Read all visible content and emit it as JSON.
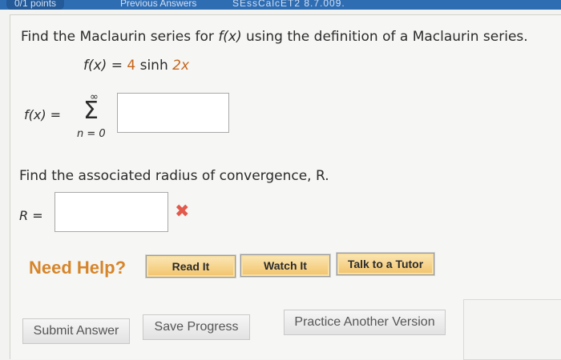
{
  "header": {
    "points": "0/1 points",
    "previous_answers": "Previous Answers",
    "problem_id": "SEssCalcET2 8.7.009."
  },
  "question1": {
    "prompt_prefix": "Find the Maclaurin series for ",
    "prompt_func": "f(x)",
    "prompt_suffix": " using the definition of a Maclaurin series.",
    "function_lhs": "f(x) = ",
    "coef": "4",
    "func_name": " sinh ",
    "arg": "2x"
  },
  "series": {
    "lhs": "f(x) = ",
    "upper": "∞",
    "symbol": "Σ",
    "lower": "n = 0",
    "answer_value": ""
  },
  "question2": {
    "prompt": "Find the associated radius of convergence, R.",
    "label": "R = ",
    "answer_value": "",
    "status_icon": "x-mark-icon",
    "status_color": "#e25a4b"
  },
  "help": {
    "title": "Need Help?",
    "read": "Read It",
    "watch": "Watch It",
    "tutor": "Talk to a Tutor",
    "accent": "#d6852a"
  },
  "footer": {
    "submit": "Submit Answer",
    "save": "Save Progress",
    "practice": "Practice Another Version"
  }
}
